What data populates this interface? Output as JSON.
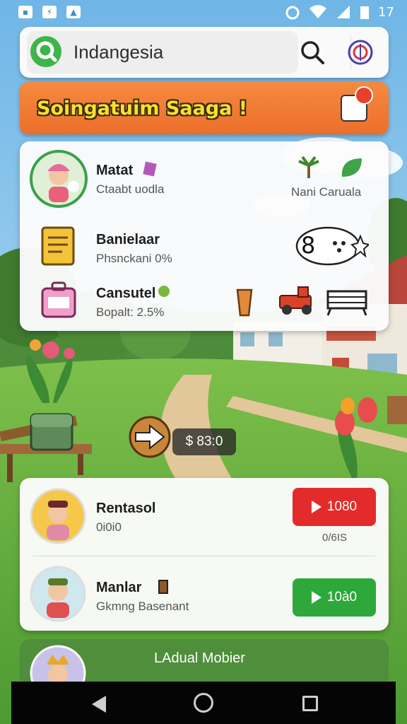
{
  "status_bar": {
    "time": "17",
    "icons": [
      "notification-icon",
      "usb-icon",
      "image-icon",
      "alarm-icon",
      "wifi-icon",
      "signal-icon",
      "battery-icon"
    ]
  },
  "search": {
    "value": "Indangesia"
  },
  "banner": {
    "title": "Soingatuim Saaga !"
  },
  "info_items": [
    {
      "name": "Matat",
      "sub": "Ctaabt uodla",
      "right_label": "Nani Caruala"
    },
    {
      "name": "Banielaar",
      "sub": "Phsnckani 0%",
      "badge": "8"
    },
    {
      "name": "Cansutel",
      "sub": "Bopalt: 2.5%"
    }
  ],
  "price": "$ 83:0",
  "friends": [
    {
      "name": "Rentasol",
      "sub": "0i0i0",
      "button_label": "1080",
      "button_color": "#e32b2b",
      "under_label": "0/6IS"
    },
    {
      "name": "Manlar",
      "sub": "Gkmng Basenant",
      "button_label": "10à0",
      "button_color": "#2ea83a"
    }
  ],
  "bottom_card": {
    "title": "LAdual Mobier"
  },
  "colors": {
    "banner": "#ef7a33",
    "banner_text": "#f8e02a",
    "play_red": "#e32b2b",
    "play_green": "#2ea83a",
    "accent_green": "#4f8e3a"
  }
}
